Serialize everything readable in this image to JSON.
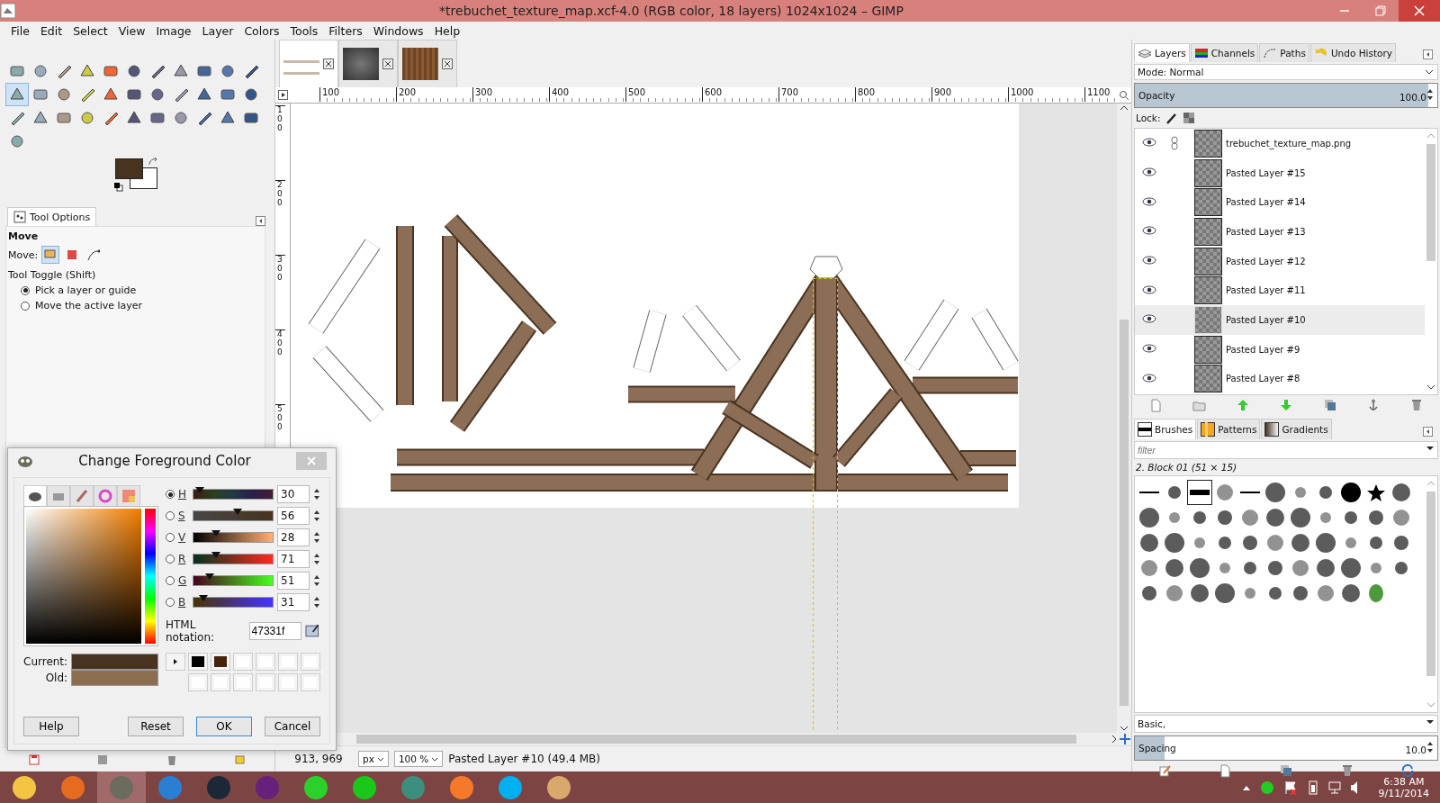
{
  "window": {
    "title": "*trebuchet_texture_map.xcf-4.0 (RGB color, 18 layers) 1024x1024 – GIMP"
  },
  "menu": [
    "File",
    "Edit",
    "Select",
    "View",
    "Image",
    "Layer",
    "Colors",
    "Tools",
    "Filters",
    "Windows",
    "Help"
  ],
  "toolbox": {
    "tools": [
      {
        "selected": false
      },
      {
        "selected": false
      },
      {
        "selected": false
      },
      {
        "selected": false
      },
      {
        "selected": false
      },
      {
        "selected": false
      },
      {
        "selected": false
      },
      {
        "selected": false
      },
      {
        "selected": false
      },
      {
        "selected": false
      },
      {
        "selected": false
      },
      {
        "selected": true
      },
      {
        "selected": false
      },
      {
        "selected": false
      },
      {
        "selected": false
      },
      {
        "selected": false
      },
      {
        "selected": false
      },
      {
        "selected": false
      },
      {
        "selected": false
      },
      {
        "selected": false
      },
      {
        "selected": false
      },
      {
        "selected": false
      },
      {
        "selected": false
      },
      {
        "selected": false
      },
      {
        "selected": false
      },
      {
        "selected": false
      },
      {
        "selected": false
      },
      {
        "selected": false
      },
      {
        "selected": false
      },
      {
        "selected": false
      },
      {
        "selected": false
      },
      {
        "selected": false
      },
      {
        "selected": false
      },
      {
        "selected": false
      }
    ]
  },
  "tool_options": {
    "tab": "Tool Options",
    "title": "Move",
    "move_label": "Move:",
    "move_modes": [
      {
        "selected": true
      },
      {
        "selected": false
      },
      {
        "selected": false
      }
    ],
    "toggle_label": "Tool Toggle  (Shift)",
    "options": [
      {
        "label": "Pick a layer or guide",
        "selected": true
      },
      {
        "label": "Move the active layer",
        "selected": false
      }
    ]
  },
  "image_tabs": [
    {
      "selected": true
    },
    {
      "selected": false
    },
    {
      "selected": false
    }
  ],
  "ruler": {
    "labels": [
      "100",
      "200",
      "300",
      "400",
      "500",
      "600",
      "700",
      "800",
      "900",
      "1000",
      "1100"
    ],
    "vertical_labels": [
      "100",
      "200",
      "300",
      "400",
      "500"
    ]
  },
  "status": {
    "coords": "913, 969",
    "unit": "px",
    "zoom": "100 %",
    "message": "Pasted Layer #10 (49.4 MB)"
  },
  "color_dialog": {
    "title": "Change Foreground Color",
    "tabs": [
      {
        "selected": true
      },
      {
        "selected": false
      },
      {
        "selected": false
      },
      {
        "selected": false
      },
      {
        "selected": false
      }
    ],
    "channels": [
      {
        "label": "H",
        "selected": true,
        "level": 0.083,
        "value": "30"
      },
      {
        "label": "S",
        "selected": false,
        "level": 0.56,
        "value": "56"
      },
      {
        "label": "V",
        "selected": false,
        "level": 0.28,
        "value": "28"
      },
      {
        "label": "R",
        "selected": false,
        "level": 0.28,
        "value": "71"
      },
      {
        "label": "G",
        "selected": false,
        "level": 0.2,
        "value": "51"
      },
      {
        "label": "B",
        "selected": false,
        "level": 0.12,
        "value": "31"
      }
    ],
    "html_label": "HTML notation:",
    "html_value": "47331f",
    "current_label": "Current:",
    "old_label": "Old:",
    "buttons": [
      "Help",
      "Reset",
      "OK",
      "Cancel"
    ]
  },
  "layers_dock": {
    "tabs": [
      {
        "label": "Layers",
        "selected": true
      },
      {
        "label": "Channels",
        "selected": false
      },
      {
        "label": "Paths",
        "selected": false
      },
      {
        "label": "Undo History",
        "selected": false
      }
    ],
    "mode": "Mode: Normal",
    "opacity": {
      "label": "Opacity",
      "value": "100.0",
      "level": 1
    },
    "lock_label": "Lock:",
    "layers": [
      {
        "name": "trebuchet_texture_map.png",
        "visible": true,
        "linked": true,
        "selected": false
      },
      {
        "name": "Pasted Layer #15",
        "visible": true,
        "linked": false,
        "selected": false
      },
      {
        "name": "Pasted Layer #14",
        "visible": true,
        "linked": false,
        "selected": false
      },
      {
        "name": "Pasted Layer #13",
        "visible": true,
        "linked": false,
        "selected": false
      },
      {
        "name": "Pasted Layer #12",
        "visible": true,
        "linked": false,
        "selected": false
      },
      {
        "name": "Pasted Layer #11",
        "visible": true,
        "linked": false,
        "selected": false
      },
      {
        "name": "Pasted Layer #10",
        "visible": true,
        "linked": false,
        "selected": true
      },
      {
        "name": "Pasted Layer #9",
        "visible": true,
        "linked": false,
        "selected": false
      },
      {
        "name": "Pasted Layer #8",
        "visible": true,
        "linked": false,
        "selected": false
      }
    ]
  },
  "brushes_dock": {
    "tabs": [
      {
        "label": "Brushes",
        "selected": true
      },
      {
        "label": "Patterns",
        "selected": false
      },
      {
        "label": "Gradients",
        "selected": false
      }
    ],
    "filter_placeholder": "filter",
    "brush_name": "2. Block 01 (51 × 15)",
    "tag": "Basic,",
    "spacing": {
      "label": "Spacing",
      "value": "10.0",
      "level": 0.1
    },
    "brushes": [
      {
        "selected": false
      },
      {
        "selected": false
      },
      {
        "selected": true
      },
      {
        "selected": false
      },
      {
        "selected": false
      },
      {
        "selected": false
      },
      {
        "selected": false
      },
      {
        "selected": false
      },
      {
        "selected": false
      },
      {
        "selected": false
      },
      {
        "selected": false
      },
      {
        "selected": false
      },
      {
        "selected": false
      },
      {
        "selected": false
      },
      {
        "selected": false
      },
      {
        "selected": false
      },
      {
        "selected": false
      },
      {
        "selected": false
      },
      {
        "selected": false
      },
      {
        "selected": false
      },
      {
        "selected": false
      },
      {
        "selected": false
      },
      {
        "selected": false
      },
      {
        "selected": false
      },
      {
        "selected": false
      },
      {
        "selected": false
      },
      {
        "selected": false
      },
      {
        "selected": false
      },
      {
        "selected": false
      },
      {
        "selected": false
      },
      {
        "selected": false
      },
      {
        "selected": false
      },
      {
        "selected": false
      },
      {
        "selected": false
      },
      {
        "selected": false
      },
      {
        "selected": false
      },
      {
        "selected": false
      },
      {
        "selected": false
      },
      {
        "selected": false
      },
      {
        "selected": false
      },
      {
        "selected": false
      },
      {
        "selected": false
      },
      {
        "selected": false
      },
      {
        "selected": false
      },
      {
        "selected": false
      },
      {
        "selected": false
      },
      {
        "selected": false
      },
      {
        "selected": false
      },
      {
        "selected": false
      },
      {
        "selected": false
      },
      {
        "selected": false
      },
      {
        "selected": false
      },
      {
        "selected": false
      },
      {
        "selected": false
      }
    ]
  },
  "taskbar": {
    "apps": [
      {
        "color": "#f4c542",
        "selected": false
      },
      {
        "color": "#e66a1f",
        "selected": false
      },
      {
        "color": "#6b6b5e",
        "selected": true
      },
      {
        "color": "#2a7fd4",
        "selected": false
      },
      {
        "color": "#1b2838",
        "selected": false
      },
      {
        "color": "#68217a",
        "selected": false
      },
      {
        "color": "#2bd12b",
        "selected": false
      },
      {
        "color": "#19c819",
        "selected": false
      },
      {
        "color": "#3c8f7c",
        "selected": false
      },
      {
        "color": "#f5792a",
        "selected": false
      },
      {
        "color": "#00aff0",
        "selected": false
      },
      {
        "color": "#d9a86c",
        "selected": false
      }
    ],
    "time": "6:38 AM",
    "date": "9/11/2014"
  }
}
